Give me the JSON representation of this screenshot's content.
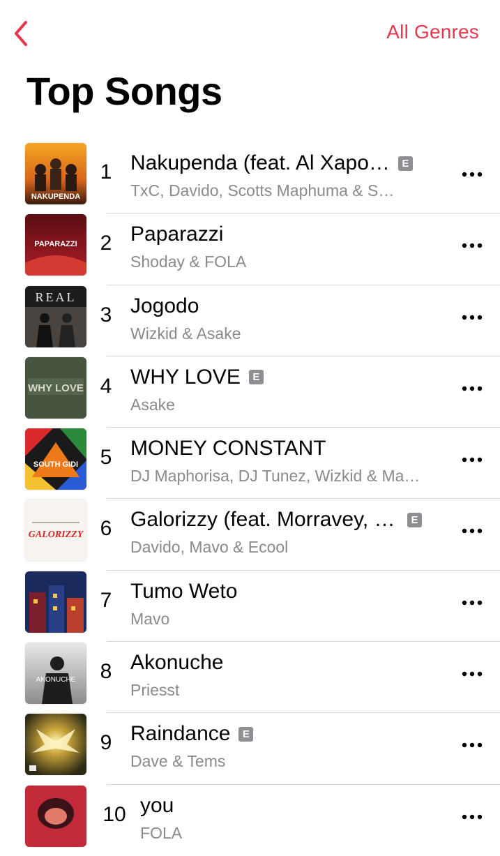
{
  "nav": {
    "back_icon": "chevron-left-icon",
    "genres_label": "All Genres",
    "accent_color": "#e5384f"
  },
  "page": {
    "title": "Top Songs"
  },
  "songs": [
    {
      "rank": "1",
      "title": "Nakupenda (feat. Al Xapo…",
      "artist": "TxC, Davido, Scotts Maphuma & S…",
      "explicit": true,
      "art_label": "NAKUPENDA"
    },
    {
      "rank": "2",
      "title": "Paparazzi",
      "artist": "Shoday & FOLA",
      "explicit": false,
      "art_label": "PAPARAZZI"
    },
    {
      "rank": "3",
      "title": "Jogodo",
      "artist": "Wizkid & Asake",
      "explicit": false,
      "art_label": "REAL"
    },
    {
      "rank": "4",
      "title": "WHY LOVE",
      "artist": "Asake",
      "explicit": true,
      "art_label": "WHY LOVE"
    },
    {
      "rank": "5",
      "title": "MONEY CONSTANT",
      "artist": "DJ Maphorisa, DJ Tunez, Wizkid & Ma…",
      "explicit": false,
      "art_label": "SOUTH GIDI"
    },
    {
      "rank": "6",
      "title": "Galorizzy (feat. Morravey, S…",
      "artist": "Davido, Mavo & Ecool",
      "explicit": true,
      "art_label": "GALORIZZY"
    },
    {
      "rank": "7",
      "title": "Tumo Weto",
      "artist": "Mavo",
      "explicit": false,
      "art_label": ""
    },
    {
      "rank": "8",
      "title": "Akonuche",
      "artist": "Priesst",
      "explicit": false,
      "art_label": "AKONUCHE"
    },
    {
      "rank": "9",
      "title": "Raindance",
      "artist": "Dave & Tems",
      "explicit": true,
      "art_label": ""
    },
    {
      "rank": "10",
      "title": "you",
      "artist": "FOLA",
      "explicit": false,
      "art_label": ""
    }
  ],
  "explicit_badge": "E",
  "more_icon": "ellipsis-icon"
}
